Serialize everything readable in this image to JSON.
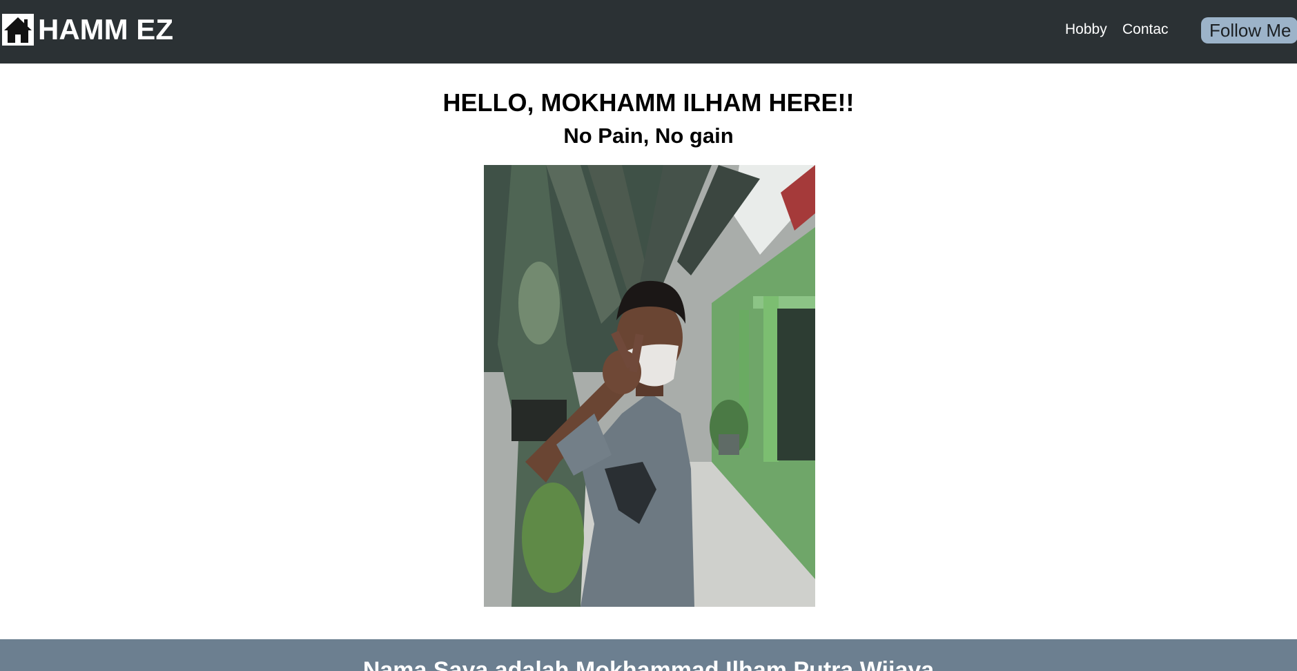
{
  "navbar": {
    "brand": "HAMM EZ",
    "brand_icon": "home-icon",
    "links": [
      "Hobby",
      "Contac"
    ],
    "follow_label": "Follow Me",
    "background": "#2b3134",
    "follow_color": "#9cb3c9"
  },
  "hero": {
    "title": "HELLO, MOKHAMM ILHAM HERE!!",
    "subtitle": "No Pain, No gain"
  },
  "about": {
    "text": "Nama Saya adalah Mokhammad Ilham Putra Wijaya",
    "background": "#6c7f90"
  }
}
